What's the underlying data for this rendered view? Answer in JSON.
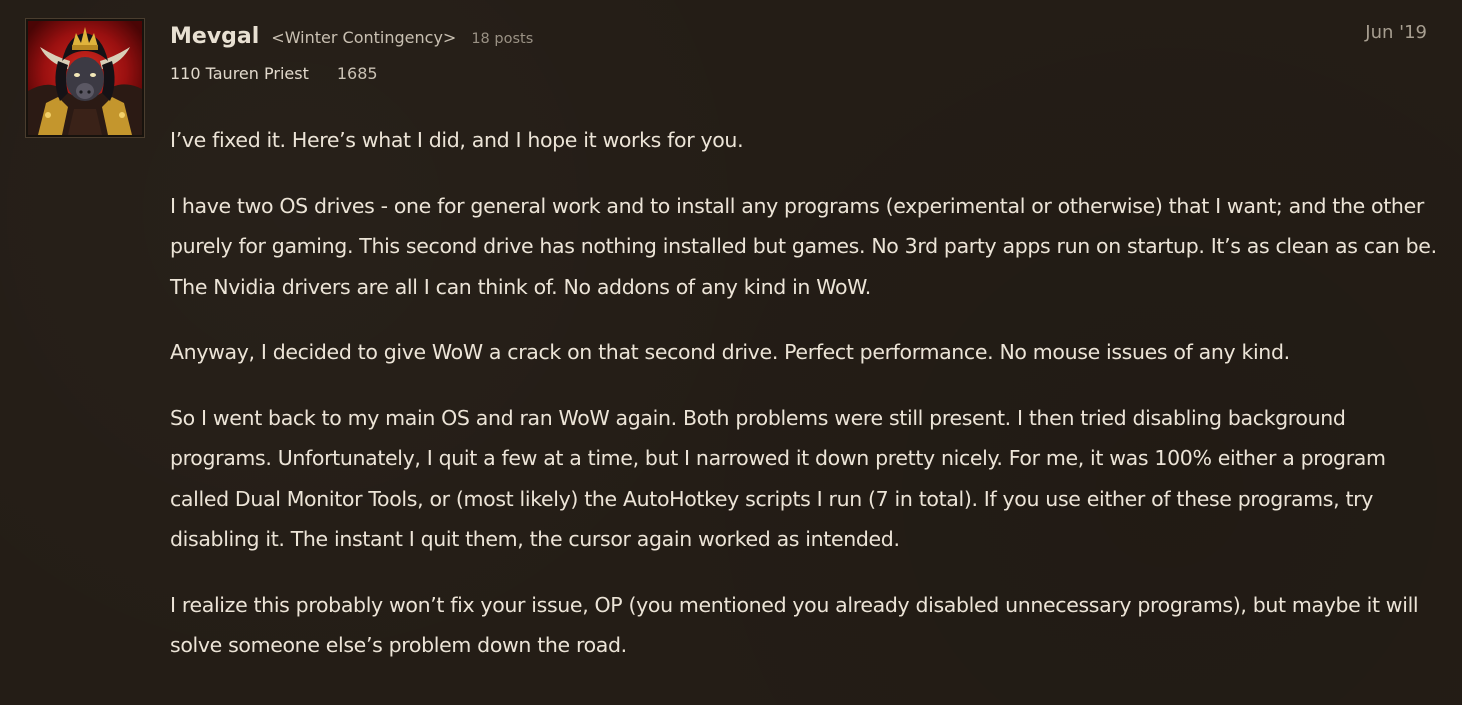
{
  "post": {
    "author": {
      "name": "Mevgal",
      "guild": "<Winter Contingency>",
      "post_count": "18 posts",
      "character": "110 Tauren Priest",
      "achievement_points": "1685",
      "avatar_icon": "tauren-priest-avatar-icon"
    },
    "date": "Jun '19",
    "paragraphs": [
      "I’ve fixed it. Here’s what I did, and I hope it works for you.",
      "I have two OS drives - one for general work and to install any programs (experimental or otherwise) that I want; and the other purely for gaming. This second drive has nothing installed but games. No 3rd party apps run on startup. It’s as clean as can be. The Nvidia drivers are all I can think of. No addons of any kind in WoW.",
      "Anyway, I decided to give WoW a crack on that second drive. Perfect performance. No mouse issues of any kind.",
      "So I went back to my main OS and ran WoW again. Both problems were still present. I then tried disabling background programs. Unfortunately, I quit a few at a time, but I narrowed it down pretty nicely. For me, it was 100% either a program called Dual Monitor Tools, or (most likely) the AutoHotkey scripts I run (7 in total). If you use either of these programs, try disabling it. The instant I quit them, the cursor again worked as intended.",
      "I realize this probably won’t fix your issue, OP (you mentioned you already disabled unnecessary programs), but maybe it will solve someone else’s problem down the road."
    ]
  },
  "colors": {
    "background": "#241d16",
    "text": "#ece4d7",
    "muted": "#a79e90"
  }
}
